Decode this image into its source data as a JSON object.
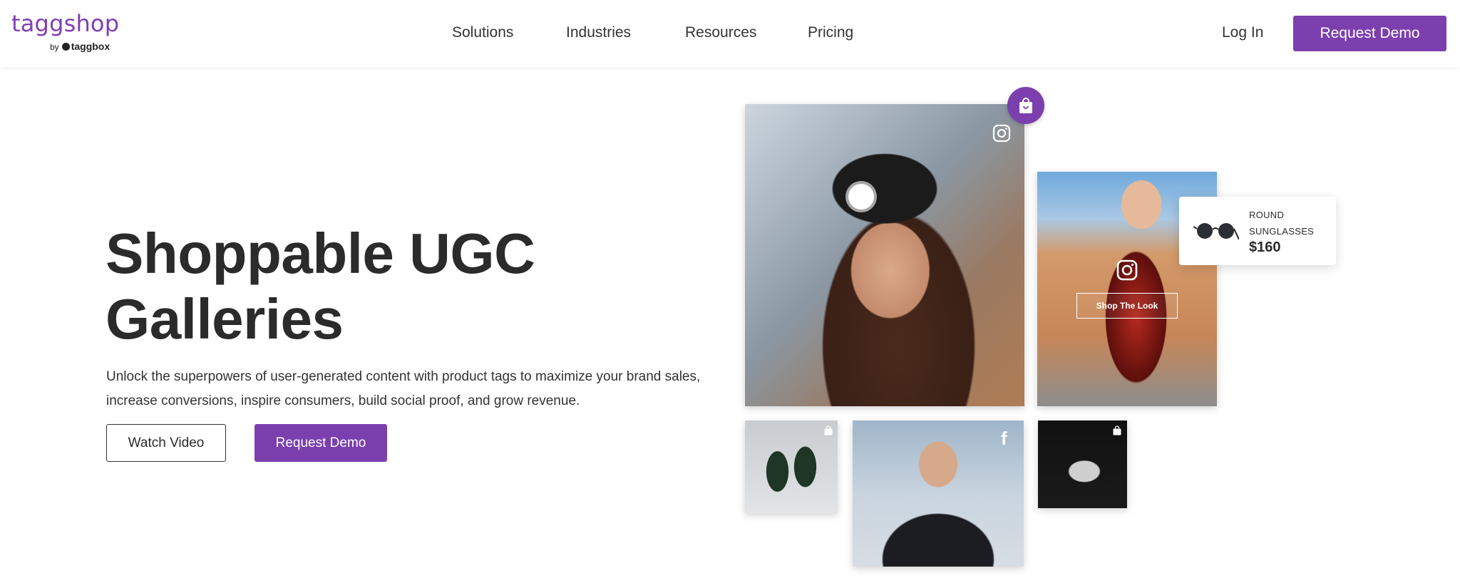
{
  "brand": {
    "name": "taggshop",
    "by": "by",
    "parent": "taggbox",
    "color": "#7b3fae"
  },
  "nav": {
    "items": [
      "Solutions",
      "Industries",
      "Resources",
      "Pricing"
    ],
    "login": "Log In",
    "cta": "Request Demo"
  },
  "hero": {
    "title_line1": "Shoppable UGC",
    "title_line2": "Galleries",
    "description": "Unlock the superpowers of user-generated content with product tags to maximize your brand sales, increase conversions, inspire consumers, build social proof, and grow revenue.",
    "watch_video": "Watch Video",
    "request_demo": "Request Demo"
  },
  "gallery": {
    "shop_the_look": "Shop The Look",
    "product": {
      "name": "ROUND SUNGLASSES",
      "price": "$160"
    },
    "icons": [
      "shopping-bag-icon",
      "instagram-icon",
      "facebook-icon"
    ],
    "facebook_glyph": "f"
  }
}
